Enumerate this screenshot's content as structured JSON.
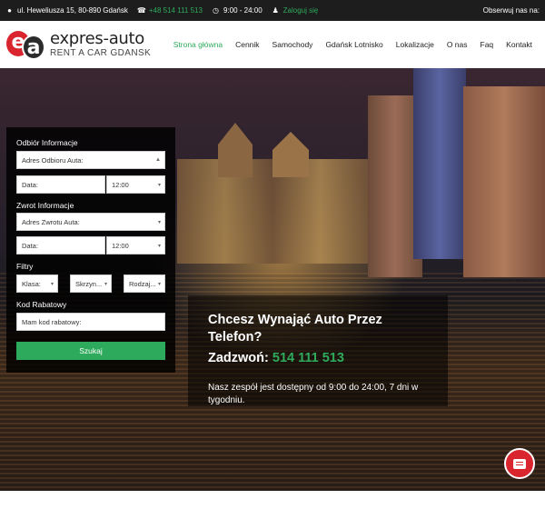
{
  "topbar": {
    "address": "ul. Heweliusza 15, 80-890 Gdańsk",
    "phone": "+48 514 111 513",
    "hours": "9:00 - 24:00",
    "login": "Zaloguj się",
    "follow": "Obserwuj nas na:",
    "icons": [
      "map-pin-icon",
      "phone-icon",
      "clock-icon",
      "user-icon"
    ]
  },
  "logo": {
    "mark_left": "e",
    "mark_right": "a",
    "title": "expres-auto",
    "subtitle": "RENT A CAR GDANSK"
  },
  "nav": {
    "items": [
      {
        "label": "Strona główna",
        "active": true
      },
      {
        "label": "Cennik"
      },
      {
        "label": "Samochody"
      },
      {
        "label": "Gdańsk Lotnisko"
      },
      {
        "label": "Lokalizacje"
      },
      {
        "label": "O nas"
      },
      {
        "label": "Faq"
      },
      {
        "label": "Kontakt"
      }
    ]
  },
  "search": {
    "pickup_label": "Odbiór Informacje",
    "pickup_address": "Adres Odbioru Auta:",
    "pickup_date": "Data:",
    "pickup_time": "12:00",
    "return_label": "Zwrot Informacje",
    "return_address": "Adres Zwrotu Auta:",
    "return_date": "Data:",
    "return_time": "12:00",
    "filters_label": "Filtry",
    "filter_class": "Klasa:",
    "filter_gearbox": "Skrzyn...",
    "filter_type": "Rodzaj...",
    "promo_label": "Kod Rabatowy",
    "promo_placeholder": "Mam kod rabatowy:",
    "submit": "Szukaj"
  },
  "phone_box": {
    "title": "Chcesz Wynająć Auto Przez Telefon?",
    "call_prefix": "Zadzwoń:",
    "number": "514 111 513",
    "text": "Nasz zespół jest dostępny od 9:00 do 24:00, 7 dni w tygodniu."
  },
  "colors": {
    "accent": "#2eaa5c",
    "brand_red": "#d8252e",
    "topbar": "#1d1d1d"
  }
}
